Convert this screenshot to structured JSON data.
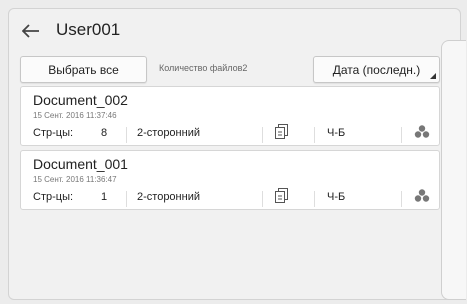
{
  "header": {
    "title": "User001"
  },
  "toolbar": {
    "select_all_label": "Выбрать все",
    "file_count": "Количество файлов2",
    "sort_label": "Дата (последн.)"
  },
  "documents": [
    {
      "name": "Document_002",
      "date": "15 Сент. 2016 11:37:46",
      "pages_label": "Стр-цы:",
      "pages": "8",
      "duplex": "2-сторонний",
      "color_mode": "Ч-Б"
    },
    {
      "name": "Document_001",
      "date": "15 Сент. 2016 11:36:47",
      "pages_label": "Стр-цы:",
      "pages": "1",
      "duplex": "2-сторонний",
      "color_mode": "Ч-Б"
    }
  ],
  "icons": {
    "back": "arrow-left-icon",
    "duplex": "duplex-page-icon",
    "tree": "tree-icon"
  }
}
